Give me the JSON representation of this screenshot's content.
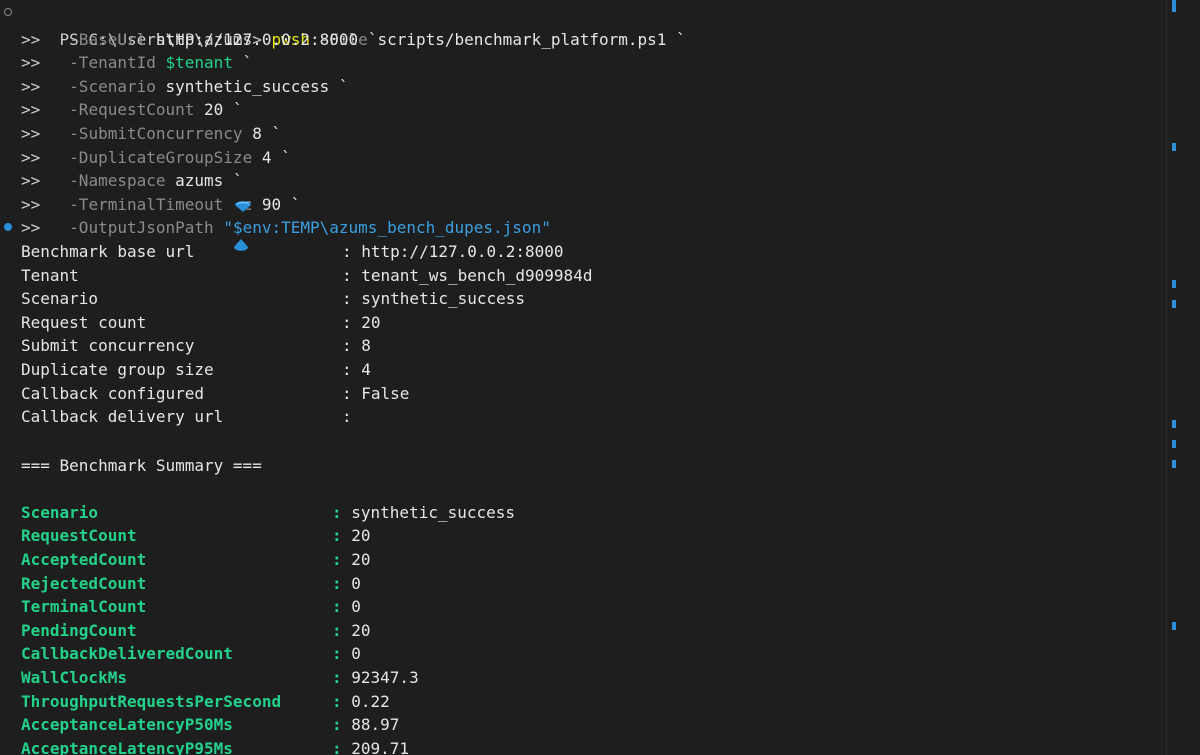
{
  "command": {
    "prompt": "PS C:\\Users\\HP\\azums>",
    "executable": "pwsh",
    "file_flag": "-File",
    "file_path": "scripts/benchmark_platform.ps1",
    "continuation": ">>",
    "backtick": "`",
    "params": [
      {
        "name": "-BaseUrl",
        "value": "http://127.0.0.2:8000",
        "kind": "val"
      },
      {
        "name": "-TenantId",
        "value": "$tenant",
        "kind": "var"
      },
      {
        "name": "-Scenario",
        "value": "synthetic_success",
        "kind": "val"
      },
      {
        "name": "-RequestCount",
        "value": "20",
        "kind": "val"
      },
      {
        "name": "-SubmitConcurrency",
        "value": "8",
        "kind": "val"
      },
      {
        "name": "-DuplicateGroupSize",
        "value": "4",
        "kind": "val"
      },
      {
        "name": "-Namespace",
        "value": "azums",
        "kind": "val"
      },
      {
        "name": "-TerminalTimeoutSec",
        "display_name": "-TerminalTimeout  c",
        "value": "90",
        "kind": "val"
      },
      {
        "name": "-OutputJsonPath",
        "value": "\"$env:TEMP\\azums_bench_dupes.json\"",
        "kind": "str"
      }
    ]
  },
  "config_output": [
    {
      "label": "Benchmark base url",
      "value": "http://127.0.0.2:8000"
    },
    {
      "label": "Tenant",
      "value": "tenant_ws_bench_d909984d"
    },
    {
      "label": "Scenario",
      "value": "synthetic_success"
    },
    {
      "label": "Request count",
      "value": "20"
    },
    {
      "label": "Submit concurrency",
      "value": "8"
    },
    {
      "label": "Duplicate group size",
      "value": "4"
    },
    {
      "label": "Callback configured",
      "value": "False"
    },
    {
      "label": "Callback delivery url",
      "value": ""
    }
  ],
  "summary_header": "=== Benchmark Summary ===",
  "summary": [
    {
      "label": "Scenario",
      "value": "synthetic_success"
    },
    {
      "label": "RequestCount",
      "value": "20"
    },
    {
      "label": "AcceptedCount",
      "value": "20"
    },
    {
      "label": "RejectedCount",
      "value": "0"
    },
    {
      "label": "TerminalCount",
      "value": "0"
    },
    {
      "label": "PendingCount",
      "value": "20"
    },
    {
      "label": "CallbackDeliveredCount",
      "value": "0"
    },
    {
      "label": "WallClockMs",
      "value": "92347.3"
    },
    {
      "label": "ThroughputRequestsPerSecond",
      "value": "0.22"
    },
    {
      "label": "AcceptanceLatencyP50Ms",
      "value": "88.97"
    },
    {
      "label": "AcceptanceLatencyP95Ms",
      "value": "209.71"
    }
  ],
  "colors": {
    "background": "#1e1e1e",
    "command_yellow": "#e5e510",
    "param_gray": "#8a8a8a",
    "variable_green": "#23d18b",
    "string_blue": "#3b9fe0",
    "accent_blue": "#2a8fd6"
  }
}
